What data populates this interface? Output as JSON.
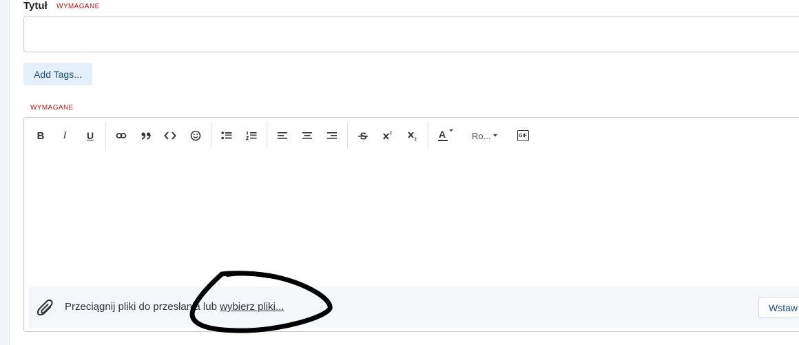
{
  "title_field": {
    "label": "Tytuł",
    "required_tag": "WYMAGANE",
    "value": "",
    "placeholder": ""
  },
  "tags": {
    "button_label": "Add Tags..."
  },
  "editor": {
    "required_tag": "WYMAGANE",
    "toolbar": {
      "bold": "B",
      "italic": "I",
      "underline": "U",
      "font_size_label": "Ro...",
      "gif_label": "GIF"
    },
    "icons": [
      "bold-icon",
      "italic-icon",
      "underline-icon",
      "link-icon",
      "quote-icon",
      "code-icon",
      "emoji-icon",
      "bullet-list-icon",
      "numbered-list-icon",
      "align-left-icon",
      "align-center-icon",
      "align-right-icon",
      "strikethrough-icon",
      "superscript-icon",
      "subscript-icon",
      "text-color-icon",
      "chevron-down-icon",
      "gif-icon",
      "paperclip-icon"
    ],
    "dropzone": {
      "text": "Przeciągnij pliki do przesłania lub ",
      "link": "wybierz pliki...",
      "insert_button": "Wstaw"
    }
  },
  "colors": {
    "required": "#b0171f",
    "accent_button_bg": "#e4eff9",
    "accent_text": "#1a4e7a",
    "dropzone_bg": "#f4f7fa",
    "annotation_stroke": "#000000"
  }
}
